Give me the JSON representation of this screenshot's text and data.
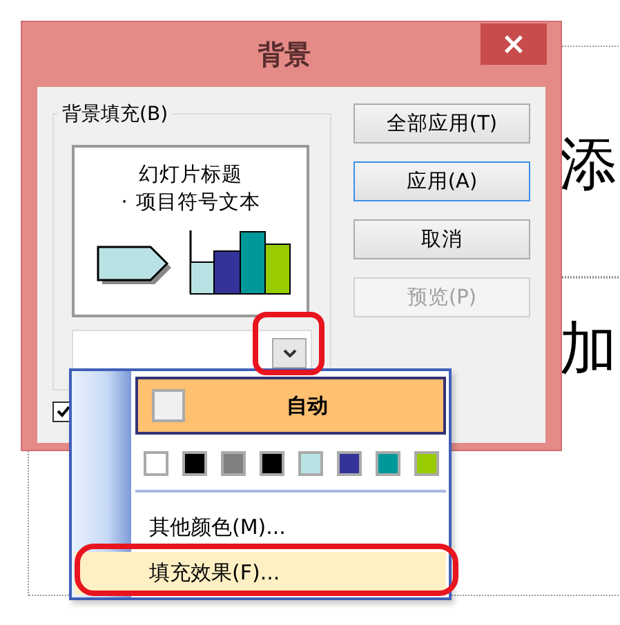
{
  "slide": {
    "texts": [
      "添",
      "加"
    ]
  },
  "dialog": {
    "title": "背景",
    "close": "×",
    "group": {
      "label": "背景填充(B)",
      "preview": {
        "title": "幻灯片标题",
        "bullet": "·",
        "body": "项目符号文本"
      }
    },
    "checkbox": {
      "checked": true
    },
    "buttons": [
      {
        "label": "全部应用(T)",
        "disabled": false,
        "focused": false
      },
      {
        "label": "应用(A)",
        "disabled": false,
        "focused": true
      },
      {
        "label": "取消",
        "disabled": false,
        "focused": false
      },
      {
        "label": "预览(P)",
        "disabled": true,
        "focused": false
      }
    ]
  },
  "menu": {
    "auto": {
      "label": "自动",
      "selected": true
    },
    "swatches": [
      {
        "color": "#ffffff"
      },
      {
        "color": "#000000"
      },
      {
        "color": "#808080"
      },
      {
        "color": "#000000"
      },
      {
        "color": "#b9e2e4"
      },
      {
        "color": "#333399"
      },
      {
        "color": "#009999"
      },
      {
        "color": "#99cc00"
      }
    ],
    "items": [
      {
        "label": "其他颜色(M)...",
        "selected": false
      },
      {
        "label": "填充效果(F)...",
        "selected": true
      }
    ]
  }
}
